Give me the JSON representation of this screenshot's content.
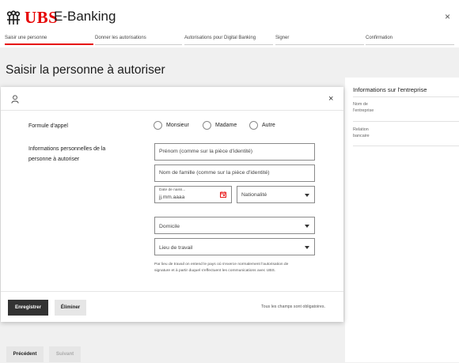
{
  "header": {
    "brand": "UBS",
    "app_title": "E-Banking",
    "close_glyph": "×"
  },
  "steps": [
    {
      "label": "Saisir une personne",
      "active": true
    },
    {
      "label": "Donner les autorisations",
      "active": false
    },
    {
      "label": "Autorisations pour Digital Banking",
      "active": false
    },
    {
      "label": "Signer",
      "active": false
    },
    {
      "label": "Confirmation",
      "active": false
    }
  ],
  "page_title": "Saisir la personne à autoriser",
  "right_panel": {
    "title": "Informations sur l'entreprise",
    "nom_line1": "Nom de",
    "nom_line2": "l'entreprise",
    "relation_line1": "Relation",
    "relation_line2": "bancaire"
  },
  "form": {
    "salutation_label": "Formule d'appel",
    "salutation_options": [
      "Monsieur",
      "Madame",
      "Autre"
    ],
    "personal_info_label_line1": "Informations personnelles de la",
    "personal_info_label_line2": "personne à autoriser",
    "first_name_placeholder": "Prénom (comme sur la pièce d'identité)",
    "last_name_placeholder": "Nom de famille (comme sur la pièce d'identité)",
    "dob_label": "Date de naiss...",
    "dob_placeholder": "jj.mm.aaaa",
    "nationality_placeholder": "Nationalité",
    "domicile_placeholder": "Domicile",
    "workplace_placeholder": "Lieu de travail",
    "help_text": "Par lieu de travail on entend le pays où s'exerce normalement l'autorisation de signature et à partir duquel s'effectuent les communications avec UBS."
  },
  "footer": {
    "save_label": "Enregistrer",
    "delete_label": "Éliminer",
    "required_note": "Tous les champs sont obligatoires."
  },
  "nav": {
    "previous_label": "Précédent",
    "next_label": "Suivant"
  },
  "colors": {
    "brand_red": "#e60000",
    "dark_button": "#333333"
  },
  "icons": {
    "logo": "ubs-keys-icon",
    "user": "user-icon",
    "close": "close-icon",
    "calendar": "calendar-icon",
    "select": "chevron-down-icon"
  }
}
